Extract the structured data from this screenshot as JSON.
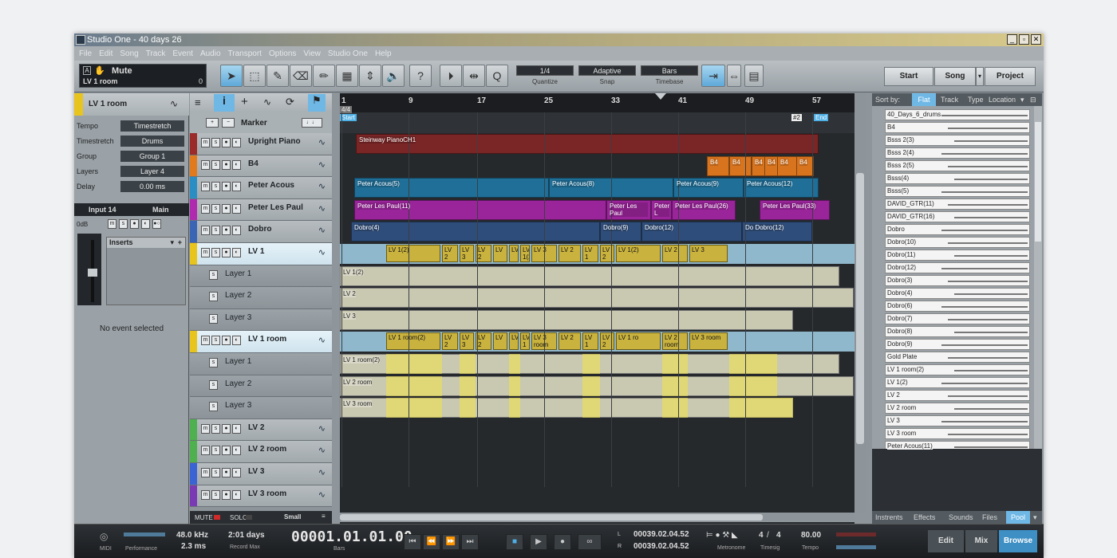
{
  "window": {
    "title": "Studio One - 40 days 26",
    "min": "_",
    "restore": "▫",
    "close": "✕"
  },
  "menu": [
    "File",
    "Edit",
    "Song",
    "Track",
    "Event",
    "Audio",
    "Transport",
    "Options",
    "View",
    "Studio One",
    "Help"
  ],
  "toolbar": {
    "mute_label": "Mute",
    "mute_track": "LV 1 room",
    "mute_value": "0",
    "quantize_value": "1/4",
    "quantize_label": "Quantize",
    "snap_value": "Adaptive",
    "snap_label": "Snap",
    "timebase_value": "Bars",
    "timebase_label": "Timebase",
    "help": "?",
    "right_buttons": [
      "Start",
      "Song",
      "Project"
    ]
  },
  "inspector": {
    "track_name": "LV 1 room",
    "rows": [
      {
        "label": "Tempo",
        "value": "Timestretch"
      },
      {
        "label": "Timestretch",
        "value": "Drums"
      },
      {
        "label": "Group",
        "value": "Group 1"
      },
      {
        "label": "Layers",
        "value": "Layer 4"
      },
      {
        "label": "Delay",
        "value": "0.00 ms"
      }
    ],
    "input_label": "Input 14",
    "main_label": "Main",
    "gain_value": "0dB",
    "inserts_label": "Inserts",
    "no_event": "No event selected"
  },
  "arrange_tools": {
    "marker_label": "Marker",
    "plus": "+",
    "minus": "−"
  },
  "ruler": {
    "bars": [
      "1",
      "9",
      "17",
      "25",
      "33",
      "41",
      "49",
      "57"
    ],
    "signature": "4/4",
    "start_marker": "Start",
    "end_marker": "End",
    "marker2": "#2"
  },
  "tracks": [
    {
      "name": "Upright Piano",
      "color": "#9b2a2a"
    },
    {
      "name": "B4",
      "color": "#e07a1c"
    },
    {
      "name": "Peter Acous",
      "color": "#2a8ec4"
    },
    {
      "name": "Peter Les Paul",
      "color": "#b02ab0"
    },
    {
      "name": "Dobro",
      "color": "#3a64b4"
    },
    {
      "name": "LV 1",
      "color": "#e8c41e",
      "selected": true
    },
    {
      "name": "Layer 1",
      "sub": true
    },
    {
      "name": "Layer 2",
      "sub": true
    },
    {
      "name": "Layer 3",
      "sub": true
    },
    {
      "name": "LV 1 room",
      "color": "#e8c41e",
      "selected": true
    },
    {
      "name": "Layer 1",
      "sub": true
    },
    {
      "name": "Layer 2",
      "sub": true
    },
    {
      "name": "Layer 3",
      "sub": true
    },
    {
      "name": "LV 2",
      "color": "#4eb04e"
    },
    {
      "name": "LV 2 room",
      "color": "#4eb04e"
    },
    {
      "name": "LV 3",
      "color": "#3a64d4"
    },
    {
      "name": "LV 3 room",
      "color": "#7a3ab4"
    }
  ],
  "trackfoot": {
    "mute": "MUTE",
    "solo": "SOLO",
    "size": "Small"
  },
  "events": {
    "piano": "Steinway PianoCH1",
    "b4": [
      "B4",
      "B4",
      "B4",
      "B4",
      "B4",
      "B4"
    ],
    "acous": [
      "Peter Acous(5)",
      "Peter Acous(8)",
      "Peter Acous(9)",
      "Peter Acous(12)"
    ],
    "lespaul": [
      "Peter Les Paul(11)",
      "Peter Les Paul",
      "Peter L",
      "Peter Les Paul(26)",
      "Peter Les Paul(33)"
    ],
    "dobro": [
      "Dobro(4)",
      "Dobro(9)",
      "Dobro(12)",
      "Do Dobro(12)"
    ],
    "lv1": [
      "LV 1(2)",
      "LV 2",
      "LV 3",
      "LV 2",
      "LV",
      "LV",
      "LV 1(2)",
      "LV 3",
      "LV 2",
      "LV 1",
      "LV 2",
      "LV 1(2)",
      "LV 2",
      "LV 3"
    ],
    "lv1_layers": [
      "LV 1(2)",
      "LV 2",
      "LV 3"
    ],
    "lv1room": [
      "LV 1 room(2)",
      "LV 2",
      "LV 3",
      "LV 2",
      "LV",
      "LV",
      "LV 1 room(2)",
      "LV 3 room",
      "LV 2",
      "LV 1",
      "LV 2 room",
      "LV 1 ro",
      "LV 2 room",
      "LV 3 room"
    ],
    "lv1room_layers": [
      "LV 1 room(2)",
      "LV 2 room",
      "LV 3 room"
    ]
  },
  "browser": {
    "sort_label": "Sort by:",
    "tabs": [
      "Flat",
      "Track",
      "Type",
      "Location"
    ],
    "items": [
      "40_Days_6_drums",
      "B4",
      "Bsss 2(3)",
      "Bsss 2(4)",
      "Bsss 2(5)",
      "Bsss(4)",
      "Bsss(5)",
      "DAVID_GTR(11)",
      "DAVID_GTR(16)",
      "Dobro",
      "Dobro(10)",
      "Dobro(11)",
      "Dobro(12)",
      "Dobro(3)",
      "Dobro(4)",
      "Dobro(6)",
      "Dobro(7)",
      "Dobro(8)",
      "Dobro(9)",
      "Gold Plate",
      "LV 1 room(2)",
      "LV 1(2)",
      "LV 2",
      "LV 2 room",
      "LV 3",
      "LV 3 room",
      "Peter Acous(11)"
    ],
    "bottom_tabs": [
      "Instrents",
      "Effects",
      "Sounds",
      "Files",
      "Pool"
    ]
  },
  "transport": {
    "midi_label": "MIDI",
    "performance_label": "Performance",
    "sample_rate": "48.0 kHz",
    "latency": "2.3 ms",
    "record_time": "2:01 days",
    "record_label": "Record Max",
    "position": "00001.01.01.00",
    "position_label": "Bars",
    "loop_l": "00039.02.04.52",
    "loop_r": "00039.02.04.52",
    "metronome_label": "Metronome",
    "timesig_num": "4",
    "timesig_den": "4",
    "timesig_label": "Timesig",
    "tempo": "80.00",
    "tempo_label": "Tempo",
    "views": [
      "Edit",
      "Mix",
      "Browse"
    ]
  }
}
